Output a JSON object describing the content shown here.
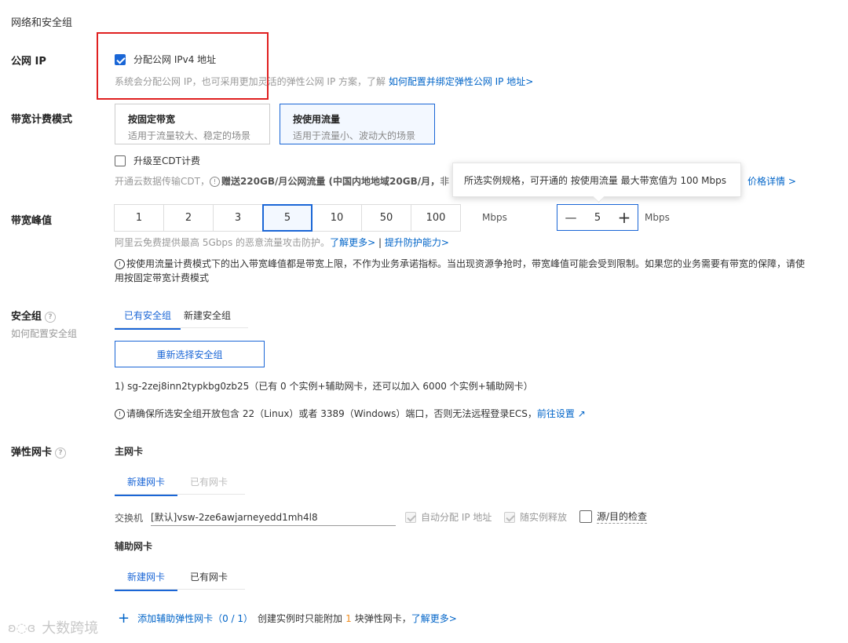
{
  "header": {
    "title": "网络和安全组"
  },
  "public_ip": {
    "label": "公网 IP",
    "checkbox_label": "分配公网 IPv4 地址",
    "hint": "系统会分配公网 IP，也可采用更加灵活的弹性公网 IP 方案，了解",
    "hint_link": "如何配置并绑定弹性公网 IP 地址>"
  },
  "billing": {
    "label": "带宽计费模式",
    "options": [
      {
        "title": "按固定带宽",
        "desc": "适用于流量较大、稳定的场景"
      },
      {
        "title": "按使用流量",
        "desc": "适用于流量小、波动大的场景"
      }
    ],
    "cdt_label": "升级至CDT计费",
    "cdt_hint": "开通云数据传输CDT，",
    "cdt_hint_bold": "赠送220GB/月公网流量 (中国内地地域20GB/月，",
    "cdt_hint_cut": "非",
    "price_link": "价格详情 >"
  },
  "tooltip": {
    "text": "所选实例规格，可开通的 按使用流量 最大带宽值为 100 Mbps"
  },
  "bandwidth": {
    "label": "带宽峰值",
    "values": [
      "1",
      "2",
      "3",
      "5",
      "10",
      "50",
      "100"
    ],
    "unit": "Mbps",
    "stepper_minus": "—",
    "stepper_value": "5",
    "stepper_plus": "+",
    "stepper_unit": "Mbps",
    "ddos_hint": "阿里云免费提供最高 5Gbps 的恶意流量攻击防护。",
    "ddos_link1": "了解更多>",
    "ddos_sep": "|",
    "ddos_link2": "提升防护能力>",
    "warning_line1": "按使用流量计费模式下的出入带宽峰值都是带宽上限，不作为业务承诺指标。当出现资源争抢时，带宽峰值可能会受到限制。如果您的业务需要有带宽的保障，请使",
    "warning_line2": "用按固定带宽计费模式"
  },
  "security_group": {
    "label": "安全组",
    "help_icon": "?",
    "sublabel": "如何配置安全组",
    "tabs": [
      "已有安全组",
      "新建安全组"
    ],
    "reselect_button": "重新选择安全组",
    "selected": "1) sg-2zej8inn2typkbg0zb25（已有 0 个实例+辅助网卡，还可以加入 6000 个实例+辅助网卡）",
    "port_warning": "请确保所选安全组开放包含 22（Linux）或者 3389（Windows）端口，否则无法远程登录ECS，",
    "port_link": "前往设置"
  },
  "eni": {
    "label": "弹性网卡",
    "help_icon": "?",
    "primary_title": "主网卡",
    "primary_tabs": [
      "新建网卡",
      "已有网卡"
    ],
    "switch_label": "交换机",
    "switch_value": "[默认]vsw-2ze6awjarneyedd1mh4l8",
    "auto_ip": "自动分配 IP 地址",
    "release": "随实例释放",
    "src_dst": "源/目的检查",
    "secondary_title": "辅助网卡",
    "secondary_tabs": [
      "新建网卡",
      "已有网卡"
    ],
    "add_icon": "+",
    "add_link": "添加辅助弹性网卡（0 / 1）",
    "add_hint_pre": "创建实例时只能附加",
    "add_hint_num": "1",
    "add_hint_post": "块弹性网卡，",
    "add_more": "了解更多>"
  },
  "watermark": "大数跨境"
}
